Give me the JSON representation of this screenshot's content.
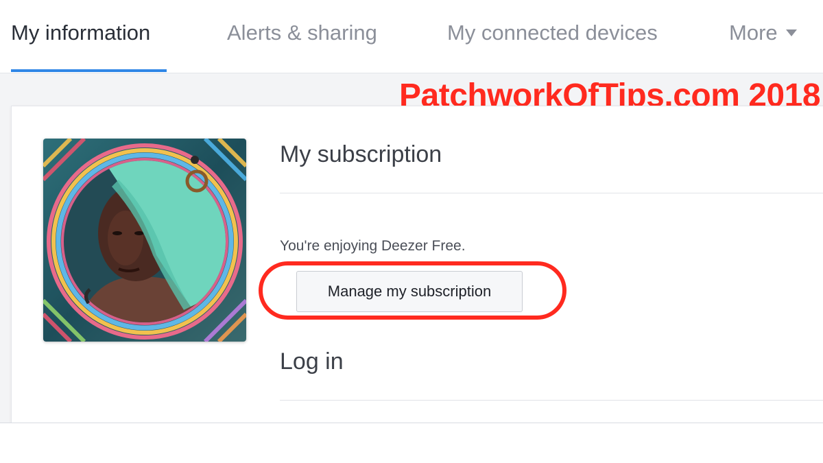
{
  "tabs": [
    {
      "label": "My information",
      "active": true
    },
    {
      "label": "Alerts & sharing",
      "active": false
    },
    {
      "label": "My connected devices",
      "active": false
    },
    {
      "label": "More",
      "active": false
    }
  ],
  "watermark": "PatchworkOfTips.com 2018",
  "subscription": {
    "title": "My subscription",
    "status_text": "You're enjoying Deezer Free.",
    "manage_button_label": "Manage my subscription"
  },
  "login": {
    "title": "Log in"
  },
  "colors": {
    "accent": "#2f86e6",
    "highlight": "#ff2a1f"
  },
  "icons": {
    "more_menu": "chevron-down-icon",
    "avatar": "profile-photo"
  }
}
